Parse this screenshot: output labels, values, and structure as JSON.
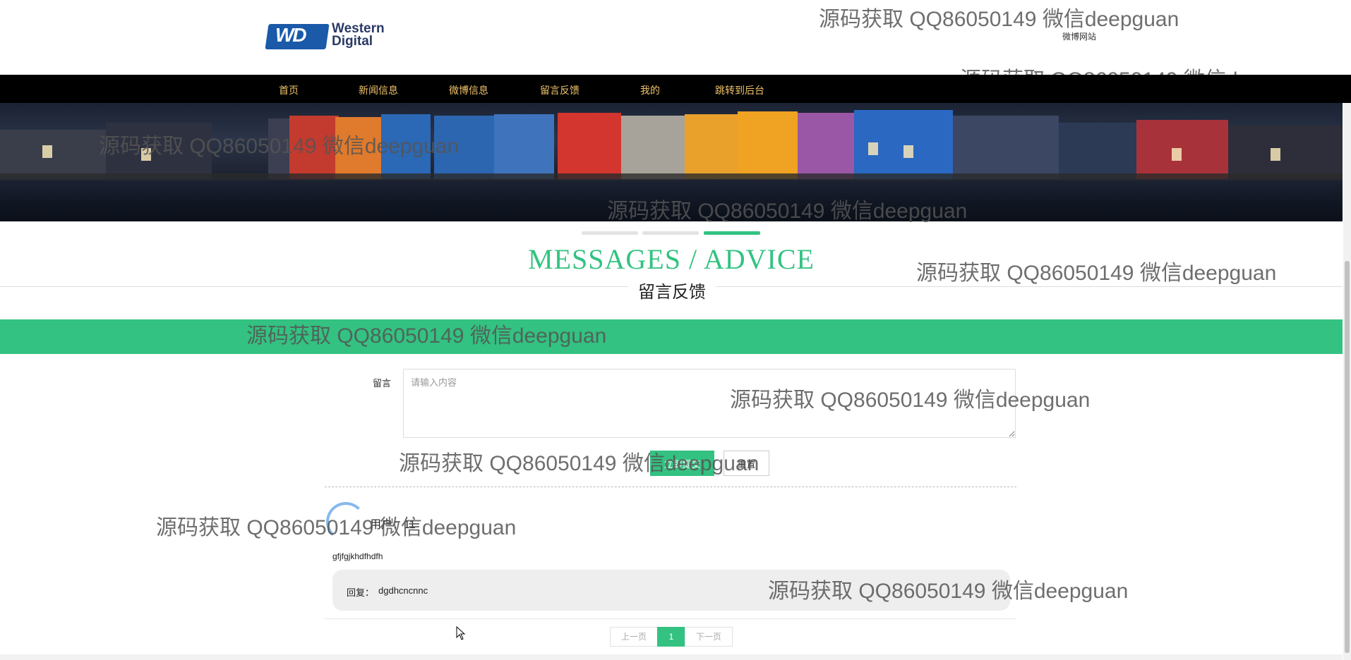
{
  "header": {
    "logo_mark": "WD",
    "logo_name_line1": "Western",
    "logo_name_line2": "Digital",
    "site_link": "微博网站"
  },
  "nav": {
    "items": [
      "首页",
      "新闻信息",
      "微博信息",
      "留言反馈",
      "我的",
      "跳转到后台"
    ]
  },
  "section": {
    "title_en": "MESSAGES / ADVICE",
    "title_cn": "留言反馈",
    "accent_color": "#33c281"
  },
  "form": {
    "label": "留言",
    "placeholder": "请输入内容",
    "value": "",
    "submit_label": "立即提交",
    "reset_label": "重置"
  },
  "messages": [
    {
      "user": "用户：11",
      "content": "gfjfgjkhdfhdfh",
      "reply_label": "回复：",
      "reply": "dgdhcncnnc"
    }
  ],
  "pagination": {
    "prev": "上一页",
    "current": "1",
    "next": "下一页"
  },
  "watermark": "源码获取 QQ86050149 微信deepguan"
}
